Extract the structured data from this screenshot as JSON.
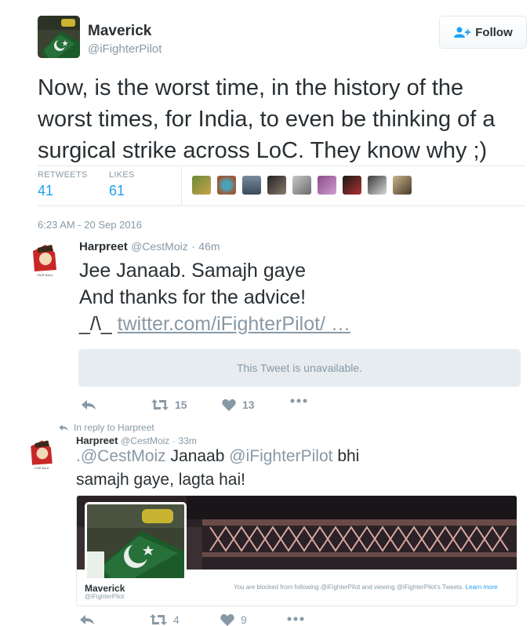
{
  "main_tweet": {
    "name": "Maverick",
    "handle": "@iFighterPilot",
    "follow_label": "Follow",
    "text": "Now, is the worst time, in the history of the worst times, for India, to even be thinking of a surgical strike across LoC. They know why ;)",
    "stats": {
      "retweets_label": "RETWEETS",
      "retweets": "41",
      "likes_label": "LIKES",
      "likes": "61"
    },
    "timestamp": "6:23 AM - 20 Sep 2016"
  },
  "reply1": {
    "name": "Harpreet",
    "handle": "@CestMoiz",
    "time": "46m",
    "line1": "Jee Janaab. Samajh gaye",
    "line2": "And thanks for the advice!",
    "line3_prefix": "_/\\_",
    "link": "twitter.com/iFighterPilot/ …",
    "unavailable": "This Tweet is unavailable.",
    "retweets": "15",
    "likes": "13"
  },
  "reply2": {
    "in_reply_to": "In reply to Harpreet",
    "name": "Harpreet",
    "handle": "@CestMoiz",
    "time": "33m",
    "mention1": ".@CestMoiz",
    "word1": "Janaab",
    "mention2": "@iFighterPilot",
    "rest1": "bhi",
    "line2": "samajh gaye, lagta hai!",
    "card": {
      "name": "Maverick",
      "handle": "@iFighterPilot",
      "blocked_text": "You are blocked from following @iFighterPilot and viewing @iFighterPilot's Tweets.",
      "learn_more": "Learn more"
    },
    "retweets": "4",
    "likes": "9"
  },
  "icons": {
    "reply": "reply-icon",
    "retweet": "retweet-icon",
    "like": "heart-icon",
    "more": "more-icon",
    "follow": "follow-user-icon"
  },
  "colors": {
    "accent": "#1da1f2",
    "muted": "#8899a6",
    "text": "#292f33",
    "border": "#e1e8ed"
  }
}
